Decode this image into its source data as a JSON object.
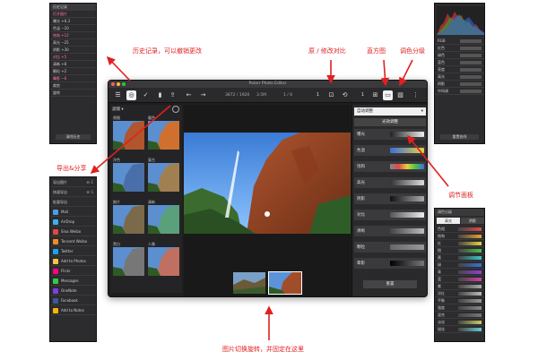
{
  "annotations": {
    "history": "历史记录，可以撤销更改",
    "export": "导出&分享",
    "compare": "原 / 修改对比",
    "histogram": "直方图",
    "grade": "调色分级",
    "adjust": "调节面板",
    "gallery": "图片切换旋转，并固定在这里"
  },
  "window": {
    "title": "Polarr Photo Editor",
    "zoom": "1",
    "info_a": "3872 / 1920",
    "info_b": "3.5M",
    "info_c": "1 / 6"
  },
  "filters": {
    "header": "滤镜 ▾",
    "items": [
      {
        "label": "原图"
      },
      {
        "label": "暖色"
      },
      {
        "label": "冷色"
      },
      {
        "label": "复古"
      },
      {
        "label": "胶片"
      },
      {
        "label": "清新"
      },
      {
        "label": "黑白"
      },
      {
        "label": "人像"
      }
    ]
  },
  "adjust": {
    "preset": "自动调整",
    "tab": "光效调整",
    "items": [
      {
        "label": "曝光"
      },
      {
        "label": "色温"
      },
      {
        "label": "饱和"
      },
      {
        "label": "高光"
      },
      {
        "label": "阴影"
      },
      {
        "label": "对比"
      },
      {
        "label": "清晰"
      },
      {
        "label": "颗粒"
      },
      {
        "label": "晕影"
      }
    ],
    "reset": "重置"
  },
  "history_panel": {
    "title": "历史记录",
    "items": [
      {
        "label": "打开图片"
      },
      {
        "label": "曝光 +0.3"
      },
      {
        "label": "色温 −10"
      },
      {
        "label": "饱和 +12"
      },
      {
        "label": "高光 −25"
      },
      {
        "label": "阴影 +30"
      },
      {
        "label": "对比 +5"
      },
      {
        "label": "清晰 +8"
      },
      {
        "label": "颗粒 +2"
      },
      {
        "label": "晕影 −6"
      },
      {
        "label": "裁剪"
      },
      {
        "label": "旋转"
      }
    ],
    "button": "清除历史"
  },
  "export_panel": {
    "items": [
      {
        "label": "导出图片",
        "hotkey": "⌘ E"
      },
      {
        "label": "快速导出",
        "hotkey": "⌘ S"
      },
      {
        "label": "批量导出",
        "hotkey": ""
      },
      {
        "label": "Mail"
      },
      {
        "label": "AirDrop"
      },
      {
        "label": "Sina Weibo"
      },
      {
        "label": "Tencent Weibo"
      },
      {
        "label": "Twitter"
      },
      {
        "label": "Add to Photos"
      },
      {
        "label": "Flickr"
      },
      {
        "label": "Messages"
      },
      {
        "label": "OneNote"
      },
      {
        "label": "Facebook"
      },
      {
        "label": "Add to Notes"
      }
    ]
  },
  "histogram_panel": {
    "rows": [
      {
        "label": "RGB"
      },
      {
        "label": "红色"
      },
      {
        "label": "绿色"
      },
      {
        "label": "蓝色"
      },
      {
        "label": "亮度"
      },
      {
        "label": "高光"
      },
      {
        "label": "阴影"
      },
      {
        "label": "中间调"
      }
    ],
    "button": "重置曲线"
  },
  "grade_panel": {
    "title": "调色分级",
    "tab_a": "高光",
    "tab_b": "阴影",
    "rows": [
      {
        "label": "色相"
      },
      {
        "label": "饱和"
      },
      {
        "label": "红"
      },
      {
        "label": "橙"
      },
      {
        "label": "黄"
      },
      {
        "label": "绿"
      },
      {
        "label": "青"
      },
      {
        "label": "蓝"
      },
      {
        "label": "紫"
      },
      {
        "label": "洋红"
      },
      {
        "label": "平衡"
      },
      {
        "label": "强度"
      },
      {
        "label": "混合"
      },
      {
        "label": "淡化"
      },
      {
        "label": "锐化"
      }
    ],
    "button": "重置"
  }
}
